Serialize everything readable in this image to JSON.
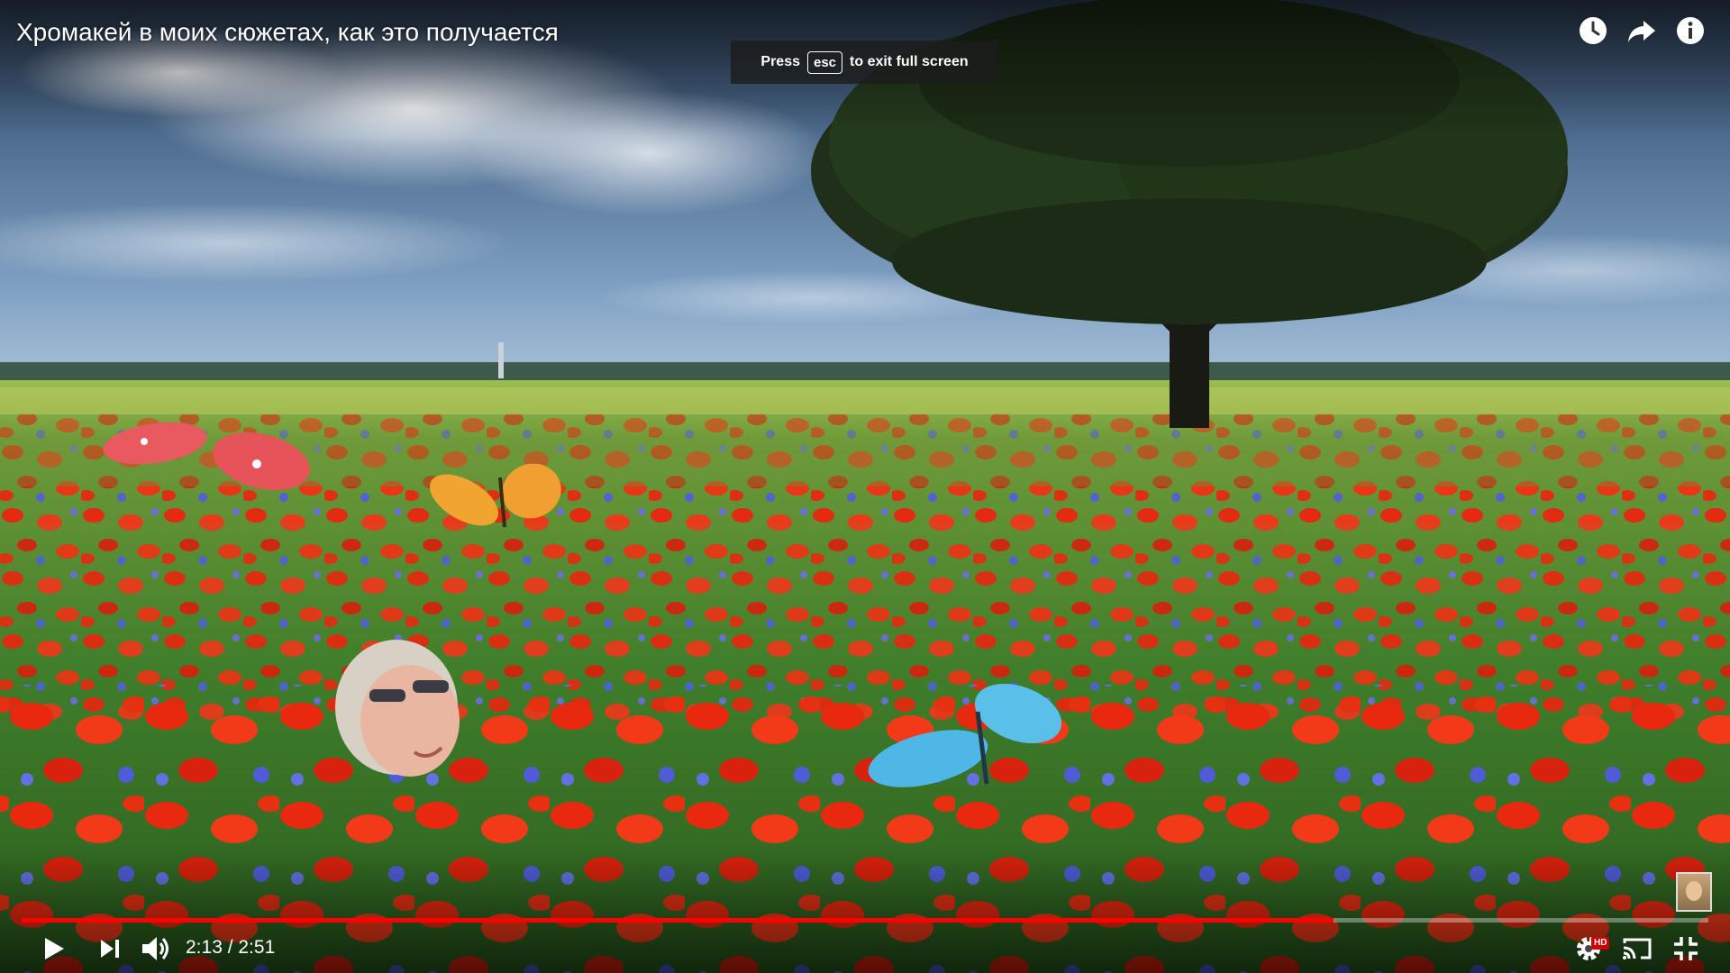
{
  "video": {
    "title": "Хромакей в моих сюжетах, как это получается",
    "current_time": "2:13",
    "duration": "2:51",
    "time_display": "2:13 / 2:51",
    "progress_fraction": 0.778
  },
  "fullscreen_notice": {
    "prefix": "Press",
    "key": "esc",
    "suffix": "to exit full screen"
  },
  "top_actions": [
    {
      "icon": "clock-icon",
      "purpose": "watch later"
    },
    {
      "icon": "share-icon",
      "purpose": "share"
    },
    {
      "icon": "info-icon",
      "purpose": "info"
    }
  ],
  "controls": {
    "play": "play-icon",
    "next": "next-icon",
    "volume": "volume-icon",
    "settings": "gear-icon",
    "settings_badge": "HD",
    "cast": "cast-icon",
    "exit_fullscreen": "exit-fullscreen-icon"
  },
  "colors": {
    "progress_played": "#ff0000",
    "progress_track": "rgba(255,255,255,0.35)",
    "hd_badge": "#cc0000"
  }
}
